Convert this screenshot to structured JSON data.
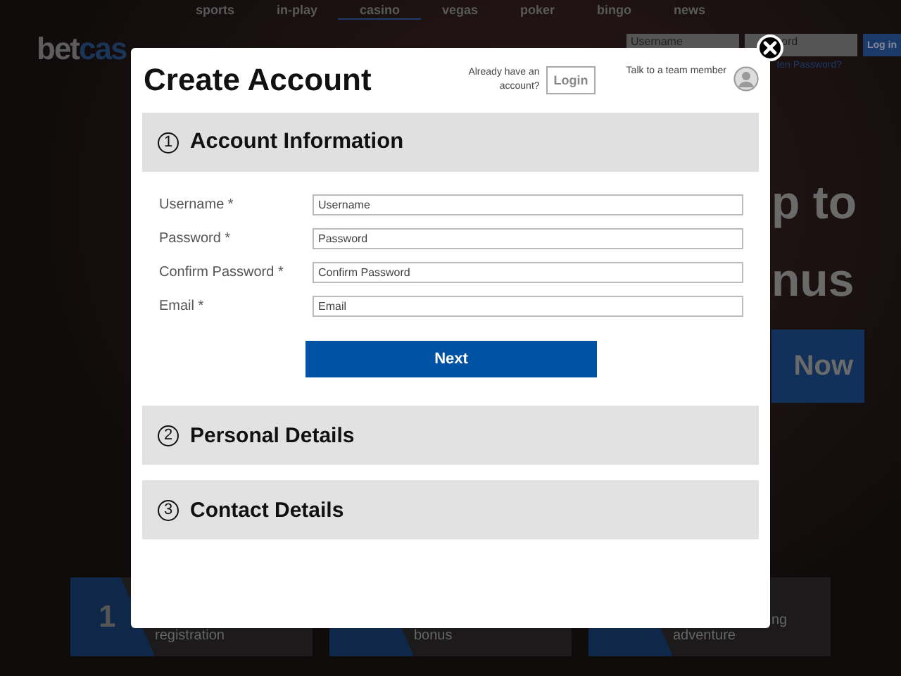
{
  "background_page": {
    "nav": [
      {
        "label": "sports",
        "selected": false
      },
      {
        "label": "in-play",
        "selected": false
      },
      {
        "label": "casino",
        "selected": true
      },
      {
        "label": "vegas",
        "selected": false
      },
      {
        "label": "poker",
        "selected": false
      },
      {
        "label": "bingo",
        "selected": false
      },
      {
        "label": "news",
        "selected": false
      }
    ],
    "logo": {
      "dark_part": "bet",
      "blue_part": "cas"
    },
    "header_login": {
      "username_placeholder": "Username",
      "password_placeholder": "ord",
      "login_button": "Log in",
      "forgot_link": "ten Password?"
    },
    "hero": {
      "headline_lines": [
        "p to",
        "nus"
      ],
      "cta": "Now"
    },
    "steps": [
      {
        "number": "1",
        "lines": [
          "registration"
        ]
      },
      {
        "lines": [
          "bonus"
        ]
      },
      {
        "lines": [
          "ng",
          "adventure"
        ]
      }
    ]
  },
  "dialog": {
    "title": "Create Account",
    "login_prompt": "Already have an account?",
    "login_button": "Login",
    "support_label": "Talk to a team member",
    "sections": [
      {
        "number": "1",
        "title": "Account Information",
        "expanded": true,
        "fields": [
          {
            "label": "Username *",
            "placeholder": "Username"
          },
          {
            "label": "Password *",
            "placeholder": "Password"
          },
          {
            "label": "Confirm Password *",
            "placeholder": "Confirm Password"
          },
          {
            "label": "Email *",
            "placeholder": "Email"
          }
        ],
        "button": "Next"
      },
      {
        "number": "2",
        "title": "Personal Details",
        "expanded": false
      },
      {
        "number": "3",
        "title": "Contact Details",
        "expanded": false
      }
    ]
  }
}
